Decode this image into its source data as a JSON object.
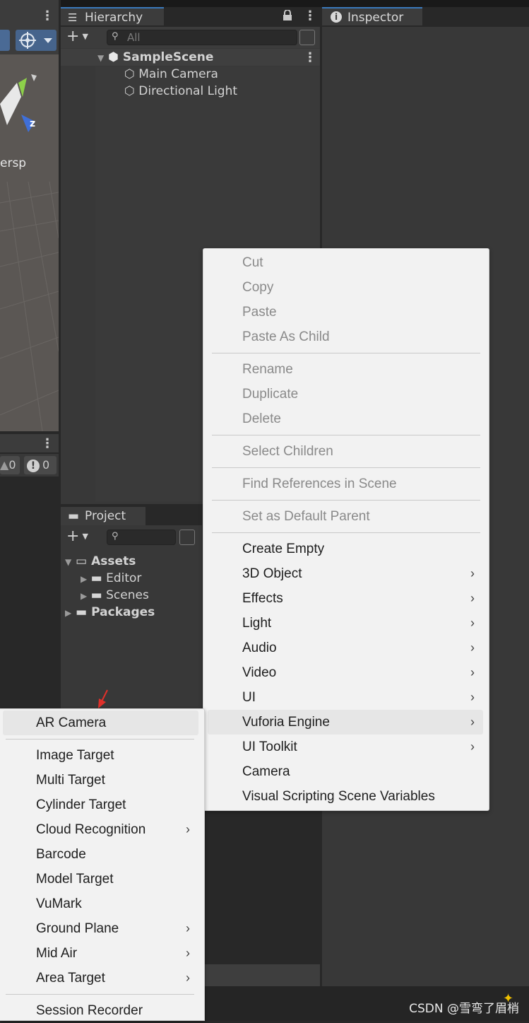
{
  "hierarchy": {
    "tab_label": "Hierarchy",
    "search_placeholder": "All",
    "scene_name": "SampleScene",
    "items": [
      "Main Camera",
      "Directional Light"
    ]
  },
  "inspector": {
    "tab_label": "Inspector"
  },
  "scene_view": {
    "persp_label": "ersp",
    "axis_label": "z",
    "warning_count": "0",
    "error_count": "0"
  },
  "project": {
    "tab_label": "Project",
    "tree": [
      {
        "label": "Assets"
      },
      {
        "label": "Editor"
      },
      {
        "label": "Scenes"
      },
      {
        "label": "Packages"
      }
    ]
  },
  "context_menu": {
    "items": [
      {
        "label": "Cut",
        "enabled": false
      },
      {
        "label": "Copy",
        "enabled": false
      },
      {
        "label": "Paste",
        "enabled": false
      },
      {
        "label": "Paste As Child",
        "enabled": false
      },
      {
        "label": "Rename",
        "enabled": false
      },
      {
        "label": "Duplicate",
        "enabled": false
      },
      {
        "label": "Delete",
        "enabled": false
      },
      {
        "label": "Select Children",
        "enabled": false
      },
      {
        "label": "Find References in Scene",
        "enabled": false
      },
      {
        "label": "Set as Default Parent",
        "enabled": false
      },
      {
        "label": "Create Empty",
        "enabled": true
      },
      {
        "label": "3D Object",
        "enabled": true,
        "submenu": true
      },
      {
        "label": "Effects",
        "enabled": true,
        "submenu": true
      },
      {
        "label": "Light",
        "enabled": true,
        "submenu": true
      },
      {
        "label": "Audio",
        "enabled": true,
        "submenu": true
      },
      {
        "label": "Video",
        "enabled": true,
        "submenu": true
      },
      {
        "label": "UI",
        "enabled": true,
        "submenu": true
      },
      {
        "label": "Vuforia Engine",
        "enabled": true,
        "submenu": true,
        "highlighted": true
      },
      {
        "label": "UI Toolkit",
        "enabled": true,
        "submenu": true
      },
      {
        "label": "Camera",
        "enabled": true
      },
      {
        "label": "Visual Scripting Scene Variables",
        "enabled": true
      }
    ]
  },
  "vuforia_submenu": {
    "items": [
      {
        "label": "AR Camera",
        "highlighted": true
      },
      {
        "label": "Image Target"
      },
      {
        "label": "Multi Target"
      },
      {
        "label": "Cylinder Target"
      },
      {
        "label": "Cloud Recognition",
        "submenu": true
      },
      {
        "label": "Barcode"
      },
      {
        "label": "Model Target"
      },
      {
        "label": "VuMark"
      },
      {
        "label": "Ground Plane",
        "submenu": true
      },
      {
        "label": "Mid Air",
        "submenu": true
      },
      {
        "label": "Area Target",
        "submenu": true
      },
      {
        "label": "Session Recorder"
      }
    ]
  },
  "colors": {
    "accent": "#3a79bb",
    "menu_bg": "#f2f2f2",
    "editor_bg": "#383838",
    "pointer_red": "#e0302a"
  },
  "watermark": "CSDN @雪弯了眉梢"
}
